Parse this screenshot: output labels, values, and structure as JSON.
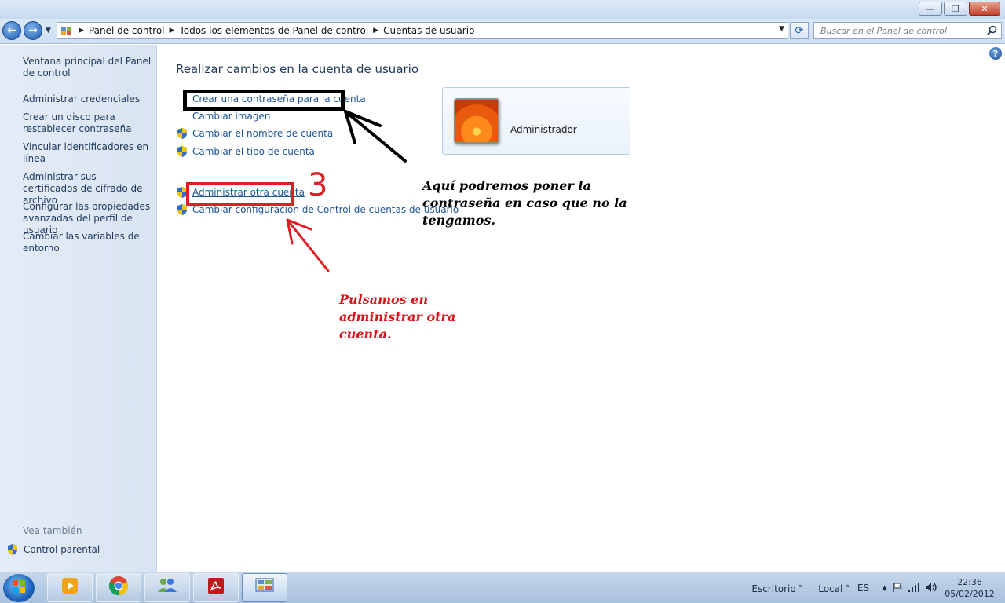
{
  "window": {
    "controls": {
      "minimize": "—",
      "maximize": "❐",
      "close": "✕"
    }
  },
  "nav": {
    "back_glyph": "←",
    "forward_glyph": "→",
    "breadcrumbs": [
      "Panel de control",
      "Todos los elementos de Panel de control",
      "Cuentas de usuario"
    ],
    "search_placeholder": "Buscar en el Panel de control"
  },
  "sidebar": {
    "links": [
      "Ventana principal del Panel de control",
      "Administrar credenciales",
      "Crear un disco para restablecer contraseña",
      "Vincular identificadores en línea",
      "Administrar sus certificados de cifrado de archivo",
      "Configurar las propiedades avanzadas del perfil de usuario",
      "Cambiar las variables de entorno"
    ],
    "see_also": "Vea también",
    "parental": "Control parental"
  },
  "main": {
    "title": "Realizar cambios en la cuenta de usuario",
    "tasks": [
      {
        "label": "Crear una contraseña para la cuenta",
        "shield": false
      },
      {
        "label": "Cambiar imagen",
        "shield": false
      },
      {
        "label": "Cambiar el nombre de cuenta",
        "shield": true
      },
      {
        "label": "Cambiar el tipo de cuenta",
        "shield": true
      },
      {
        "label": "Administrar otra cuenta",
        "shield": true
      },
      {
        "label": "Cambiar configuración de Control de cuentas de usuario",
        "shield": true
      }
    ],
    "account_name": "Administrador"
  },
  "annotations": {
    "black_text": "Aquí podremos poner la contraseña en caso que no la tengamos.",
    "red_text": "Pulsamos en administrar otra cuenta.",
    "step_number": "3"
  },
  "taskbar": {
    "apps": [
      "media-player-icon",
      "chrome-icon",
      "users-icon",
      "acrobat-icon",
      "control-panel-icon"
    ],
    "tray": {
      "desktop": "Escritorio",
      "local": "Local",
      "lang": "ES",
      "time": "22:36",
      "date": "05/02/2012"
    }
  },
  "colors": {
    "link": "#1e5597",
    "annotation_red": "#e01e25",
    "annotation_black": "#000000"
  }
}
